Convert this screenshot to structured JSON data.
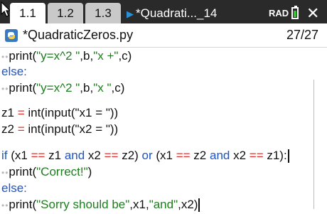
{
  "tabs": [
    {
      "label": "1.1"
    },
    {
      "label": "1.2"
    },
    {
      "label": "1.3"
    }
  ],
  "doc_tab": {
    "label": "*Quadrati..._14"
  },
  "status": {
    "angle_mode": "RAD"
  },
  "file": {
    "name": "*QuadraticZeros.py",
    "page": "27/27"
  },
  "code": {
    "l1": {
      "dots": "••",
      "fn": "print(",
      "s1": "\"y=x^2 \"",
      "a": ",b,",
      "s2": "\"x +\"",
      "b": ",c)"
    },
    "l2": {
      "kw": "else:"
    },
    "l3": {
      "dots": "••",
      "fn": "print(",
      "s1": "\"y=x^2 \"",
      "a": ",b,",
      "s2": "\"x \"",
      "b": ",c)"
    },
    "l5": {
      "v": "z1 ",
      "eq": "=",
      "rest": " int(input(\"x1 = \"))"
    },
    "l6": {
      "v": "z2 ",
      "eq": "=",
      "rest": " int(input(\"x2 = \"))"
    },
    "l8": {
      "if": "if",
      "p1": " (x1 ",
      "op1": "==",
      "p2": " z1 ",
      "and1": "and",
      "p3": " x2 ",
      "op2": "==",
      "p4": " z2) ",
      "or": "or",
      "p5": " (x1 ",
      "op3": "==",
      "p6": " z2 ",
      "and2": "and",
      "p7": " x2 ",
      "op4": "==",
      "p8": " z1):"
    },
    "l9": {
      "dots": "••",
      "fn": "print(",
      "s1": "\"Correct!\"",
      "b": ")"
    },
    "l10": {
      "kw": "else:"
    },
    "l11": {
      "dots": "••",
      "fn": "print(",
      "s1": "\"Sorry should be\"",
      "a": ",x1,",
      "s2": "\"and\"",
      "b": ",x2)"
    }
  },
  "icons": {
    "python": "python-file-icon",
    "close": "close-icon",
    "battery": "battery-icon",
    "pointer": "mouse-pointer-icon"
  }
}
